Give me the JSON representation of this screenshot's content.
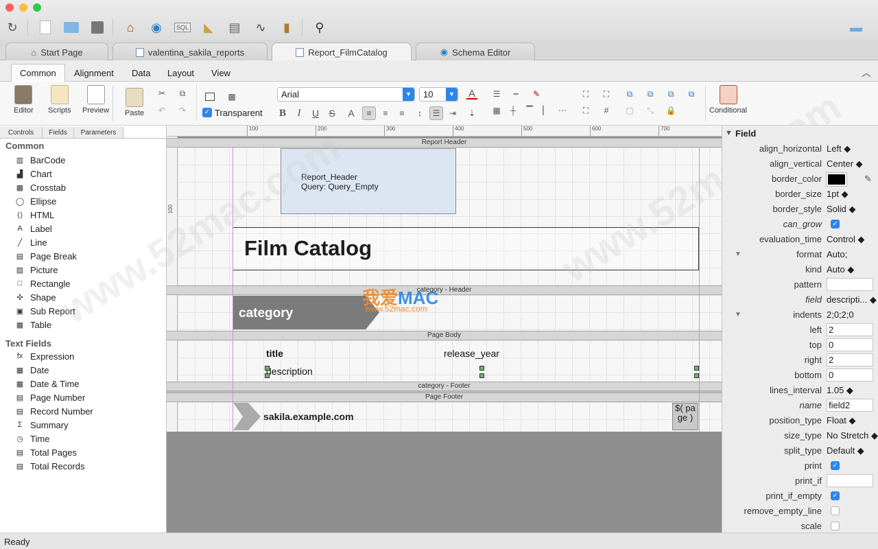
{
  "tabs": [
    {
      "label": "Start Page"
    },
    {
      "label": "valentina_sakila_reports"
    },
    {
      "label": "Report_FilmCatalog"
    },
    {
      "label": "Schema Editor"
    }
  ],
  "ribbon_tabs": [
    "Common",
    "Alignment",
    "Data",
    "Layout",
    "View"
  ],
  "ribbon": {
    "editor": "Editor",
    "scripts": "Scripts",
    "preview": "Preview",
    "paste": "Paste",
    "transparent": "Transparent",
    "font": "Arial",
    "size": "10",
    "conditional": "Conditional"
  },
  "left_tabs": [
    "Controls",
    "Fields",
    "Parameters"
  ],
  "common_group": "Common",
  "common_items": [
    {
      "label": "BarCode",
      "icon": "barcode-icon",
      "glyph": "▥"
    },
    {
      "label": "Chart",
      "icon": "chart-icon",
      "glyph": "▟"
    },
    {
      "label": "Crosstab",
      "icon": "crosstab-icon",
      "glyph": "▦"
    },
    {
      "label": "Ellipse",
      "icon": "ellipse-icon",
      "glyph": "◯"
    },
    {
      "label": "HTML",
      "icon": "html-icon",
      "glyph": "⟨⟩"
    },
    {
      "label": "Label",
      "icon": "label-icon",
      "glyph": "A"
    },
    {
      "label": "Line",
      "icon": "line-icon",
      "glyph": "╱"
    },
    {
      "label": "Page Break",
      "icon": "page-break-icon",
      "glyph": "▤"
    },
    {
      "label": "Picture",
      "icon": "picture-icon",
      "glyph": "▨"
    },
    {
      "label": "Rectangle",
      "icon": "rectangle-icon",
      "glyph": "□"
    },
    {
      "label": "Shape",
      "icon": "shape-icon",
      "glyph": "✣"
    },
    {
      "label": "Sub Report",
      "icon": "sub-report-icon",
      "glyph": "▣"
    },
    {
      "label": "Table",
      "icon": "table-icon",
      "glyph": "▦"
    }
  ],
  "text_group": "Text Fields",
  "text_items": [
    {
      "label": "Expression",
      "icon": "expression-icon",
      "glyph": "fx"
    },
    {
      "label": "Date",
      "icon": "date-icon",
      "glyph": "▦"
    },
    {
      "label": "Date & Time",
      "icon": "date-time-icon",
      "glyph": "▦"
    },
    {
      "label": "Page Number",
      "icon": "page-number-icon",
      "glyph": "▤"
    },
    {
      "label": "Record Number",
      "icon": "record-number-icon",
      "glyph": "▤"
    },
    {
      "label": "Summary",
      "icon": "summary-icon",
      "glyph": "Σ"
    },
    {
      "label": "Time",
      "icon": "time-icon",
      "glyph": "◷"
    },
    {
      "label": "Total Pages",
      "icon": "total-pages-icon",
      "glyph": "▤"
    },
    {
      "label": "Total Records",
      "icon": "total-records-icon",
      "glyph": "▤"
    }
  ],
  "ruler_ticks": [
    "100",
    "200",
    "300",
    "400",
    "500",
    "600",
    "700"
  ],
  "ruler_v": "100",
  "report": {
    "bands": {
      "report_header": "Report Header",
      "cat_header": "category - Header",
      "page_body": "Page Body",
      "cat_footer": "category - Footer",
      "page_footer": "Page Footer"
    },
    "rh_line1": "Report_Header",
    "rh_line2": "Query: Query_Empty",
    "title": "Film Catalog",
    "category": "category",
    "f_title": "title",
    "f_release": "release_year",
    "f_desc": "description",
    "footer_url": "sakila.example.com",
    "page_expr": "$( page )"
  },
  "watermark": {
    "site": "www.52mac.com",
    "brand1": "我爱",
    "brand2": "MAC",
    "sub": "www.52mac.com"
  },
  "props": {
    "section": "Field",
    "rows": [
      {
        "label": "align_horizontal",
        "value": "Left ◆"
      },
      {
        "label": "align_vertical",
        "value": "Center ◆"
      },
      {
        "label": "border_color",
        "value": ""
      },
      {
        "label": "border_size",
        "value": "1pt ◆"
      },
      {
        "label": "border_style",
        "value": "Solid ◆"
      },
      {
        "label": "can_grow",
        "value": ""
      },
      {
        "label": "evaluation_time",
        "value": "Control ◆"
      },
      {
        "label": "format",
        "value": "Auto;"
      },
      {
        "label": "kind",
        "value": "Auto ◆"
      },
      {
        "label": "pattern",
        "value": ""
      },
      {
        "label": "field",
        "value": "descripti... ◆"
      },
      {
        "label": "indents",
        "value": "2;0;2;0"
      },
      {
        "label": "left",
        "value": "2"
      },
      {
        "label": "top",
        "value": "0"
      },
      {
        "label": "right",
        "value": "2"
      },
      {
        "label": "bottom",
        "value": "0"
      },
      {
        "label": "lines_interval",
        "value": "1.05 ◆"
      },
      {
        "label": "name",
        "value": "field2"
      },
      {
        "label": "position_type",
        "value": "Float ◆"
      },
      {
        "label": "size_type",
        "value": "No Stretch ◆"
      },
      {
        "label": "split_type",
        "value": "Default ◆"
      },
      {
        "label": "print",
        "value": ""
      },
      {
        "label": "print_if",
        "value": ""
      },
      {
        "label": "print_if_empty",
        "value": ""
      },
      {
        "label": "remove_empty_line",
        "value": ""
      },
      {
        "label": "scale",
        "value": ""
      }
    ]
  },
  "status": "Ready",
  "colors": {
    "accent": "#2d86e8",
    "band": "#d6d6d6",
    "category_bg": "#7b7b7b",
    "header_box": "#dce6f3"
  }
}
